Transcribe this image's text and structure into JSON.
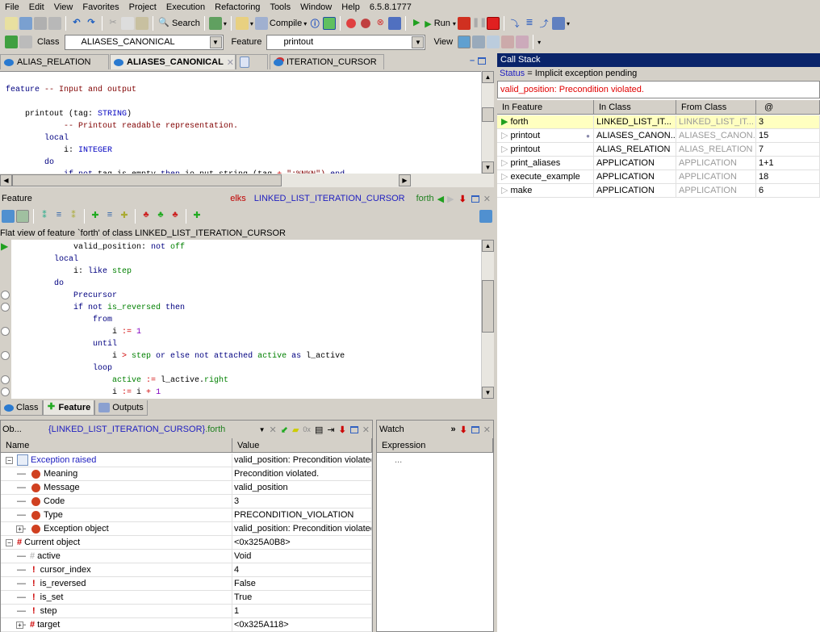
{
  "menu": [
    "File",
    "Edit",
    "View",
    "Favorites",
    "Project",
    "Execution",
    "Refactoring",
    "Tools",
    "Window",
    "Help",
    "6.5.8.1777"
  ],
  "toolbar": {
    "search": "Search",
    "compile": "Compile",
    "run": "Run",
    "class_label": "Class",
    "class_value": "ALIASES_CANONICAL",
    "feature_label": "Feature",
    "feature_value": "printout",
    "view_label": "View"
  },
  "editor_tabs": [
    {
      "label": "ALIAS_RELATION"
    },
    {
      "label": "ALIASES_CANONICAL",
      "active": true
    },
    {
      "label": ""
    },
    {
      "label": "ITERATION_CURSOR"
    }
  ],
  "editor_lines": [
    {
      "indent": 0,
      "tokens": [
        [
          "feature",
          "kw"
        ],
        [
          " -- Input and output",
          "cm"
        ]
      ]
    },
    {
      "indent": 0,
      "tokens": []
    },
    {
      "indent": 1,
      "tokens": [
        [
          "printout (tag: ",
          "id"
        ],
        [
          "STRING",
          "ty"
        ],
        [
          ")",
          "id"
        ]
      ]
    },
    {
      "indent": 3,
      "tokens": [
        [
          "-- Printout readable representation.",
          "cm"
        ]
      ]
    },
    {
      "indent": 2,
      "tokens": [
        [
          "local",
          "kw"
        ]
      ]
    },
    {
      "indent": 3,
      "tokens": [
        [
          "i: ",
          "id"
        ],
        [
          "INTEGER",
          "ty"
        ]
      ]
    },
    {
      "indent": 2,
      "tokens": [
        [
          "do",
          "kw"
        ]
      ]
    },
    {
      "indent": 3,
      "tokens": [
        [
          "if not ",
          "kw"
        ],
        [
          "tag.is_empty ",
          "id"
        ],
        [
          "then ",
          "kw"
        ],
        [
          "io.put_string (tag ",
          "id"
        ],
        [
          "+",
          "op"
        ],
        [
          " \":%N%N\") ",
          "cm"
        ],
        [
          "end",
          "kw"
        ]
      ]
    }
  ],
  "feature_panel": {
    "title": "Feature",
    "cluster": "elks",
    "class": "LINKED_LIST_ITERATION_CURSOR",
    "feature": "forth",
    "info": "Flat view of feature `forth' of class LINKED_LIST_ITERATION_CURSOR"
  },
  "flat_lines": [
    {
      "indent": 3,
      "bp": "current",
      "tokens": [
        [
          "valid_position: ",
          "id"
        ],
        [
          "not ",
          "kw"
        ],
        [
          "off",
          "ft"
        ]
      ]
    },
    {
      "indent": 2,
      "bp": "",
      "tokens": [
        [
          "local",
          "kw"
        ]
      ]
    },
    {
      "indent": 3,
      "bp": "",
      "tokens": [
        [
          "i: ",
          "id"
        ],
        [
          "like ",
          "kw"
        ],
        [
          "step",
          "ft"
        ]
      ]
    },
    {
      "indent": 2,
      "bp": "",
      "tokens": [
        [
          "do",
          "kw"
        ]
      ]
    },
    {
      "indent": 3,
      "bp": "empty",
      "tokens": [
        [
          "Precursor",
          "kw"
        ]
      ]
    },
    {
      "indent": 3,
      "bp": "empty",
      "tokens": [
        [
          "if not ",
          "kw"
        ],
        [
          "is_reversed ",
          "ft"
        ],
        [
          "then",
          "kw"
        ]
      ]
    },
    {
      "indent": 4,
      "bp": "",
      "tokens": [
        [
          "from",
          "kw"
        ]
      ]
    },
    {
      "indent": 5,
      "bp": "empty",
      "tokens": [
        [
          "i ",
          "id"
        ],
        [
          ":=",
          "op"
        ],
        [
          " 1",
          "nm"
        ]
      ]
    },
    {
      "indent": 4,
      "bp": "",
      "tokens": [
        [
          "until",
          "kw"
        ]
      ]
    },
    {
      "indent": 5,
      "bp": "empty",
      "tokens": [
        [
          "i ",
          "id"
        ],
        [
          ">",
          "op"
        ],
        [
          " step ",
          "ft"
        ],
        [
          "or else not attached ",
          "kw"
        ],
        [
          "active ",
          "ft"
        ],
        [
          "as ",
          "kw"
        ],
        [
          "l_active",
          "id"
        ]
      ]
    },
    {
      "indent": 4,
      "bp": "",
      "tokens": [
        [
          "loop",
          "kw"
        ]
      ]
    },
    {
      "indent": 5,
      "bp": "empty",
      "tokens": [
        [
          "active ",
          "ft"
        ],
        [
          ":=",
          "op"
        ],
        [
          " l_active.",
          "id"
        ],
        [
          "right",
          "ft"
        ]
      ]
    },
    {
      "indent": 5,
      "bp": "empty",
      "tokens": [
        [
          "i ",
          "id"
        ],
        [
          ":=",
          "op"
        ],
        [
          " i ",
          "id"
        ],
        [
          "+",
          "op"
        ],
        [
          " 1",
          "nm"
        ]
      ]
    }
  ],
  "bottom_tabs": [
    {
      "label": "Class"
    },
    {
      "label": "Feature",
      "active": true
    },
    {
      "label": "Outputs"
    }
  ],
  "objects": {
    "title": "Ob...",
    "context_class": "{LINKED_LIST_ITERATION_CURSOR}",
    "context_feature": ".forth",
    "hex_label": "0x",
    "columns": [
      "Name",
      "Value"
    ],
    "rows": [
      {
        "level": 0,
        "expander": "minus",
        "icon": "exception",
        "name": "Exception raised",
        "value": "valid_position: Precondition violated",
        "link": true
      },
      {
        "level": 1,
        "icon": "error",
        "name": "Meaning",
        "value": "Precondition violated."
      },
      {
        "level": 1,
        "icon": "error",
        "name": "Message",
        "value": "valid_position"
      },
      {
        "level": 1,
        "icon": "error",
        "name": "Code",
        "value": "3"
      },
      {
        "level": 1,
        "icon": "error",
        "name": "Type",
        "value": "PRECONDITION_VIOLATION"
      },
      {
        "level": 1,
        "expander": "plus",
        "icon": "error",
        "name": "Exception object",
        "value": "valid_position: Precondition violated"
      },
      {
        "level": 0,
        "expander": "minus",
        "icon": "object",
        "name": "Current object",
        "value": "<0x325A0B8>"
      },
      {
        "level": 1,
        "icon": "void",
        "name": "active",
        "value": "Void"
      },
      {
        "level": 1,
        "icon": "attribute",
        "name": "cursor_index",
        "value": "4"
      },
      {
        "level": 1,
        "icon": "attribute",
        "name": "is_reversed",
        "value": "False"
      },
      {
        "level": 1,
        "icon": "attribute",
        "name": "is_set",
        "value": "True"
      },
      {
        "level": 1,
        "icon": "attribute",
        "name": "step",
        "value": "1"
      },
      {
        "level": 1,
        "expander": "plus",
        "icon": "object",
        "name": "target",
        "value": "<0x325A118>"
      }
    ]
  },
  "watch": {
    "title": "Watch",
    "column": "Expression",
    "placeholder": "..."
  },
  "call_stack": {
    "title": "Call Stack",
    "status_label": "Status",
    "status_value": " = Implicit exception pending",
    "message": "valid_position: Precondition violated.",
    "columns": [
      "In Feature",
      "In Class",
      "From Class",
      "@"
    ],
    "rows": [
      {
        "feature": "forth",
        "class": "LINKED_LIST_IT...",
        "from": "LINKED_LIST_IT...",
        "at": "3",
        "current": true
      },
      {
        "feature": "printout",
        "class": "ALIASES_CANON...",
        "from": "ALIASES_CANON...",
        "at": "15",
        "marker": true
      },
      {
        "feature": "printout",
        "class": "ALIAS_RELATION",
        "from": "ALIAS_RELATION",
        "at": "7"
      },
      {
        "feature": "print_aliases",
        "class": "APPLICATION",
        "from": "APPLICATION",
        "at": "1+1"
      },
      {
        "feature": "execute_example",
        "class": "APPLICATION",
        "from": "APPLICATION",
        "at": "18"
      },
      {
        "feature": "make",
        "class": "APPLICATION",
        "from": "APPLICATION",
        "at": "6"
      }
    ]
  },
  "colors": {
    "title_bar": "#0a246a",
    "current_row": "#ffffc0",
    "error_text": "#e00000",
    "link": "#2020c0"
  }
}
